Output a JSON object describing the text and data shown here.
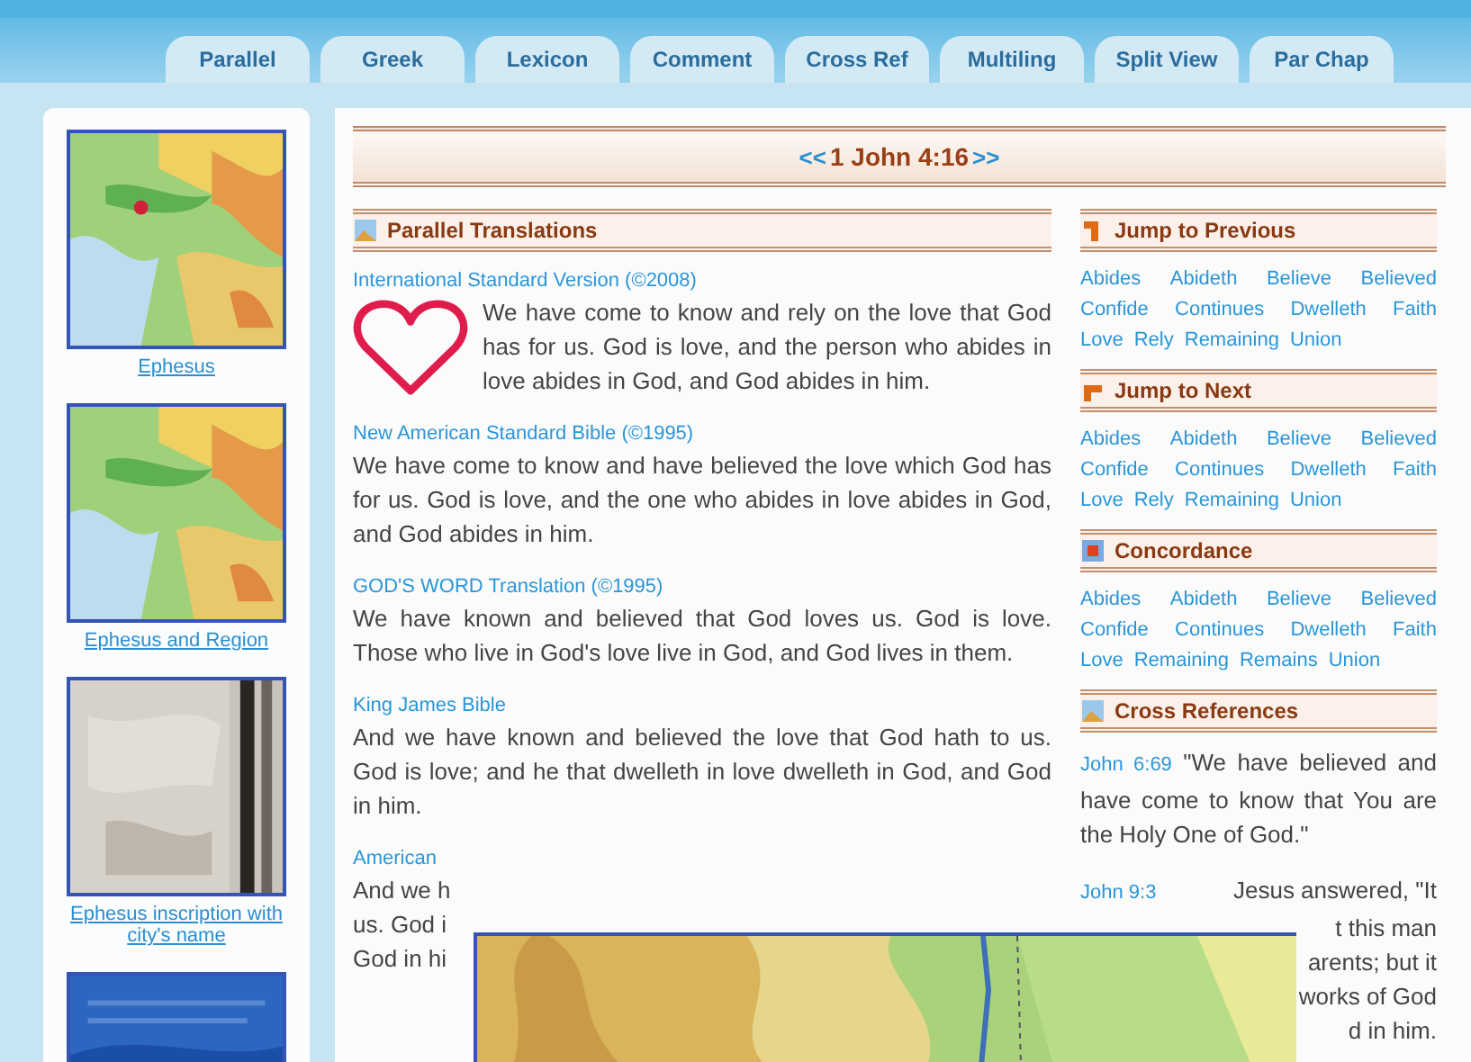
{
  "tabs": [
    {
      "label": "Parallel"
    },
    {
      "label": "Greek"
    },
    {
      "label": "Lexicon"
    },
    {
      "label": "Comment"
    },
    {
      "label": "Cross Ref"
    },
    {
      "label": "Multiling"
    },
    {
      "label": "Split View"
    },
    {
      "label": "Par Chap"
    }
  ],
  "sidebar": {
    "items": [
      {
        "kind": "map",
        "caption": "Ephesus"
      },
      {
        "kind": "map",
        "caption": "Ephesus and Region"
      },
      {
        "kind": "stone",
        "caption": "Ephesus inscription with city's name"
      },
      {
        "kind": "blue"
      }
    ]
  },
  "nav": {
    "prev": "<<",
    "reference": "1 John 4:16",
    "next": ">>"
  },
  "parallel": {
    "title": "Parallel Translations",
    "entries": [
      {
        "kind": "full",
        "version": "International Standard Version (©2008)",
        "text": "We have come to know and rely on the love that God has for us. God is love, and the person who abides in love abides in God, and God abides in him."
      },
      {
        "kind": "full",
        "version": "New American Standard Bible (©1995)",
        "text": "We have come to know and have believed the love which God has for us. God is love, and the one who abides in love abides in God, and God abides in him."
      },
      {
        "kind": "full",
        "version": "GOD'S WORD Translation (©1995)",
        "text": "We have known and believed that God loves us. God is love. Those who live in God's love live in God, and God lives in them."
      },
      {
        "kind": "full",
        "version": "King James Bible",
        "text": "And we have known and believed the love that God hath to us. God is love; and he that dwelleth in love dwelleth in God, and God in him."
      },
      {
        "kind": "partial",
        "version": "American",
        "lines": [
          "And we h",
          "us. God i",
          "God in hi"
        ]
      }
    ]
  },
  "side_sections": [
    {
      "kind": "words",
      "title": "Jump to Previous",
      "words": [
        "Abides",
        "Abideth",
        "Believe",
        "Believed",
        "Confide",
        "Continues",
        "Dwelleth",
        "Faith",
        "Love",
        "Rely",
        "Remaining",
        "Union"
      ]
    },
    {
      "kind": "words",
      "title": "Jump to Next",
      "words": [
        "Abides",
        "Abideth",
        "Believe",
        "Believed",
        "Confide",
        "Continues",
        "Dwelleth",
        "Faith",
        "Love",
        "Rely",
        "Remaining",
        "Union"
      ]
    },
    {
      "kind": "words",
      "title": "Concordance",
      "words": [
        "Abides",
        "Abideth",
        "Believe",
        "Believed",
        "Confide",
        "Continues",
        "Dwelleth",
        "Faith",
        "Love",
        "Remaining",
        "Remains",
        "Union"
      ]
    },
    {
      "kind": "refs",
      "title": "Cross References",
      "refs": [
        {
          "kind": "full",
          "ref": "John 6:69",
          "text": "\"We have believed and have come to know that You are the Holy One of God.\""
        },
        {
          "kind": "partial",
          "ref": "John 9:3",
          "text": "Jesus answered, \"It",
          "lines": [
            "t this man",
            "arents; but it",
            "works of God",
            "d in him."
          ]
        }
      ]
    }
  ]
}
